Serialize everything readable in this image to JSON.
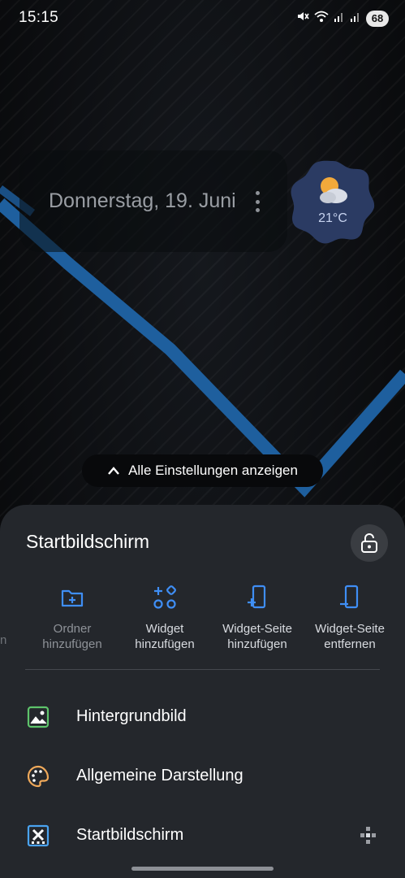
{
  "status_bar": {
    "time": "15:15",
    "battery": "68"
  },
  "date_widget": {
    "date": "Donnerstag, 19. Juni"
  },
  "weather_widget": {
    "temperature": "21°C",
    "icon": "partly-cloudy-icon"
  },
  "all_settings": {
    "label": "Alle Einstellungen anzeigen"
  },
  "sheet": {
    "title": "Startbildschirm",
    "edge_text": "n",
    "shortcuts": [
      {
        "label_line1": "Ordner",
        "label_line2": "hinzufügen",
        "icon": "add-folder-icon",
        "enabled": false
      },
      {
        "label_line1": "Widget",
        "label_line2": "hinzufügen",
        "icon": "add-widget-icon",
        "enabled": true
      },
      {
        "label_line1": "Widget-Seite",
        "label_line2": "hinzufügen",
        "icon": "add-widget-page-icon",
        "enabled": true
      },
      {
        "label_line1": "Widget-Seite",
        "label_line2": "entfernen",
        "icon": "remove-widget-page-icon",
        "enabled": true
      }
    ],
    "rows": [
      {
        "label": "Hintergrundbild",
        "icon": "wallpaper-icon"
      },
      {
        "label": "Allgemeine Darstellung",
        "icon": "palette-icon"
      },
      {
        "label": "Startbildschirm",
        "icon": "home-grid-icon"
      }
    ]
  },
  "colors": {
    "accent": "#3f8ef5",
    "sheet_bg": "#24272c",
    "wallpaper_line": "#1e5f9e"
  }
}
